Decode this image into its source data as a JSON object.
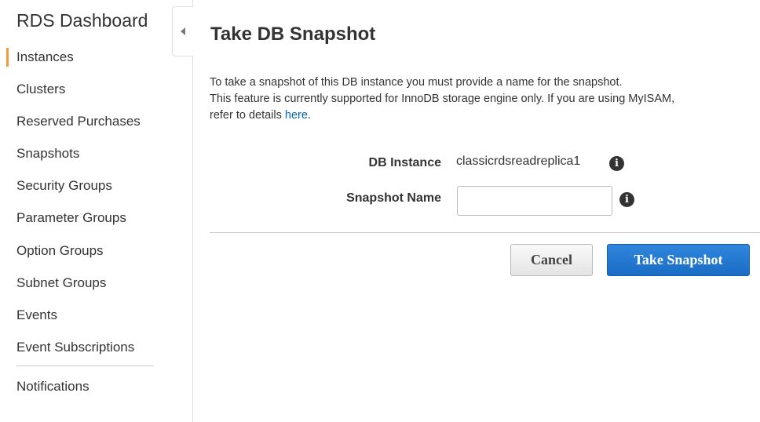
{
  "sidebar": {
    "title": "RDS Dashboard",
    "items": [
      {
        "label": "Instances",
        "active": true
      },
      {
        "label": "Clusters",
        "active": false
      },
      {
        "label": "Reserved Purchases",
        "active": false
      },
      {
        "label": "Snapshots",
        "active": false
      },
      {
        "label": "Security Groups",
        "active": false
      },
      {
        "label": "Parameter Groups",
        "active": false
      },
      {
        "label": "Option Groups",
        "active": false
      },
      {
        "label": "Subnet Groups",
        "active": false
      },
      {
        "label": "Events",
        "active": false
      },
      {
        "label": "Event Subscriptions",
        "active": false
      }
    ],
    "notifications_label": "Notifications",
    "active_color": "#f19d38"
  },
  "main": {
    "title": "Take DB Snapshot",
    "description": {
      "line1": "To take a snapshot of this DB instance you must provide a name for the snapshot.",
      "line2": "This feature is currently supported for InnoDB storage engine only. If you are using MyISAM,",
      "line3_prefix": "refer to details",
      "link_text": "here",
      "line3_suffix": "."
    },
    "form": {
      "db_instance_label": "DB Instance",
      "db_instance_value": "classicrdsreadreplica1",
      "snapshot_name_label": "Snapshot Name",
      "snapshot_name_value": "",
      "info_icon_glyph": "i"
    },
    "buttons": {
      "cancel_label": "Cancel",
      "submit_label": "Take Snapshot",
      "primary_color": "#1a6cc4"
    }
  }
}
